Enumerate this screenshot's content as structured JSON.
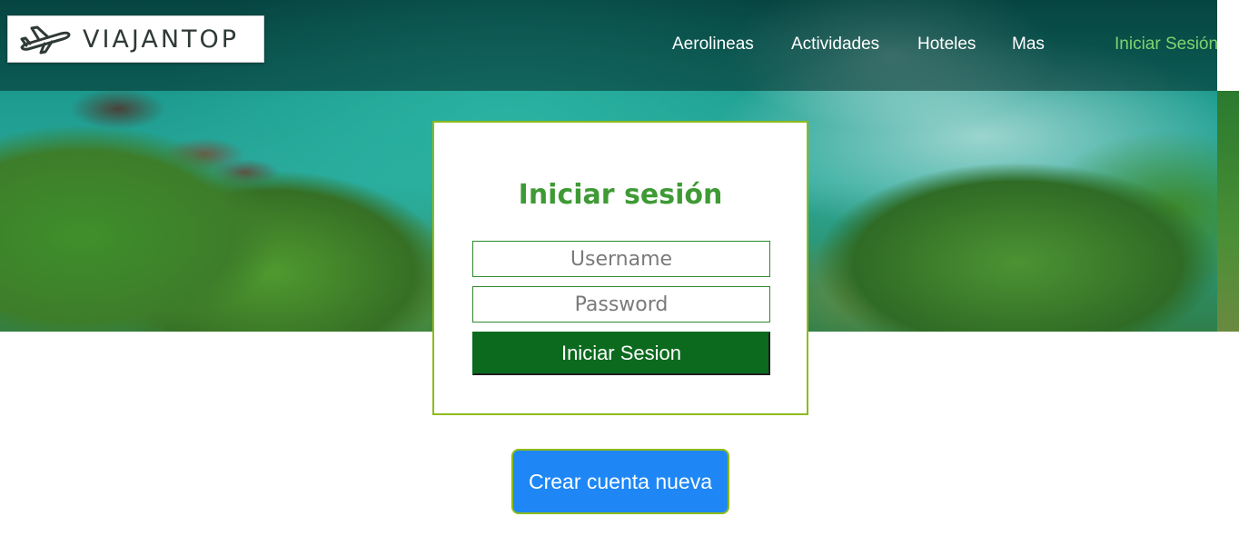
{
  "brand": {
    "name": "VIAJANTOP",
    "logo_icon": "airplane-icon"
  },
  "nav": {
    "items": [
      "Aerolineas",
      "Actividades",
      "Hoteles",
      "Mas"
    ],
    "login_label": "Iniciar Sesión",
    "login_color": "#7fd46e"
  },
  "login_form": {
    "title": "Iniciar sesión",
    "username_placeholder": "Username",
    "username_value": "",
    "password_placeholder": "Password",
    "password_value": "",
    "submit_label": "Iniciar Sesion",
    "title_color": "#3f9a35",
    "submit_color": "#0b6a1e",
    "border_color": "#8dbb1a"
  },
  "create_account": {
    "label": "Crear cuenta nueva",
    "color": "#1e87f5"
  }
}
